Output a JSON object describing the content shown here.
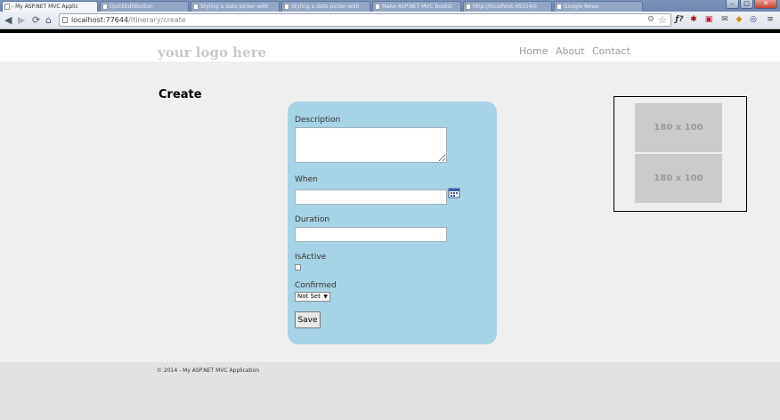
{
  "browser": {
    "tabs": [
      {
        "label": "- My ASP.NET MVC Applic",
        "active": true
      },
      {
        "label": "QuickEditButton",
        "active": false
      },
      {
        "label": "Styling a date picker with",
        "active": false
      },
      {
        "label": "Styling a date picker with",
        "active": false
      },
      {
        "label": "Make ASP.NET MVC Bootst",
        "active": false
      },
      {
        "label": "http://localhost:49224/li",
        "active": false
      },
      {
        "label": "Google News",
        "active": false
      }
    ],
    "url_host": "localhost:77644",
    "url_path": "/Itinerary/create",
    "window_buttons": {
      "minimize": "–",
      "maximize": "□",
      "close": "✕"
    },
    "nav_icons": {
      "back": "◀",
      "forward": "▶",
      "reload": "⟳",
      "home": "⌂"
    },
    "extension_icons": [
      "ƒ?",
      "✱",
      "▣",
      "✉",
      "◆",
      "◎",
      "≡"
    ]
  },
  "site": {
    "logo": "your logo here",
    "nav": [
      "Home",
      "About",
      "Contact"
    ]
  },
  "page": {
    "title": "Create",
    "form": {
      "description_label": "Description",
      "when_label": "When",
      "duration_label": "Duration",
      "isactive_label": "IsActive",
      "confirmed_label": "Confirmed",
      "confirmed_value": "Not Set",
      "save_label": "Save"
    },
    "ads": [
      "180 x 100",
      "180 x 100"
    ]
  },
  "footer": {
    "text": "© 2014 - My ASP.NET MVC Application"
  },
  "colors": {
    "form_bg": "#a7d3e6",
    "placeholder_bg": "#cbcbcb"
  }
}
